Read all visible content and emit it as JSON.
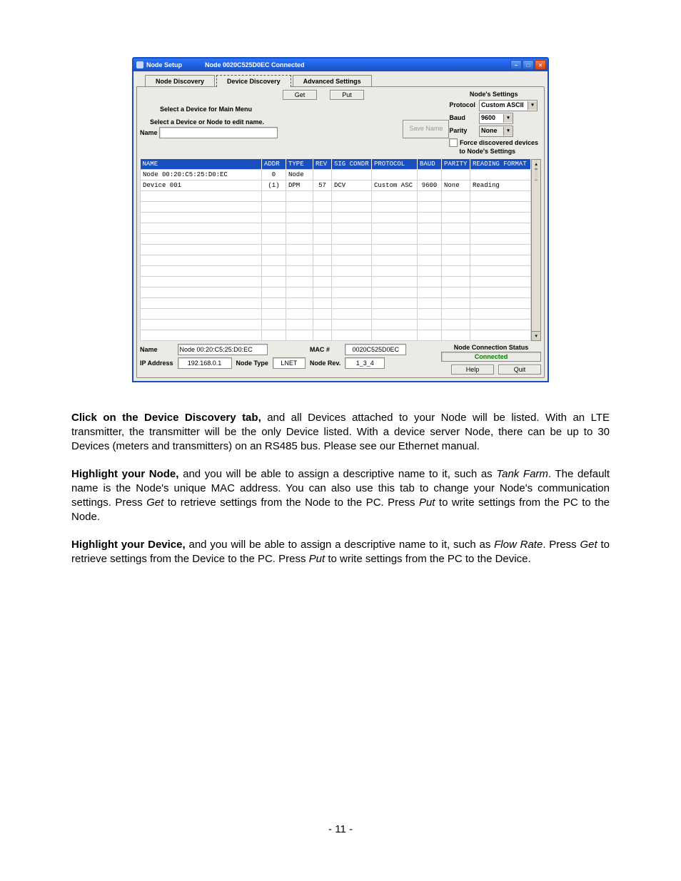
{
  "window": {
    "title_prefix": "Node Setup",
    "title_status": "Node 0020C525D0EC Connected"
  },
  "tabs": {
    "node_discovery": "Node Discovery",
    "device_discovery": "Device Discovery",
    "advanced_settings": "Advanced Settings"
  },
  "buttons": {
    "get": "Get",
    "put": "Put",
    "save_name": "Save Name",
    "help": "Help",
    "quit": "Quit"
  },
  "labels": {
    "select_device_main": "Select a Device for Main Menu",
    "select_device_edit": "Select a Device or Node to edit name.",
    "name": "Name",
    "node_settings": "Node's Settings",
    "protocol": "Protocol",
    "baud": "Baud",
    "parity": "Parity",
    "force_discovered": "Force discovered devices",
    "force_discovered2": "to Node's Settings",
    "footer_name": "Name",
    "footer_ip": "IP Address",
    "footer_mac": "MAC #",
    "footer_nodetype": "Node Type",
    "footer_noderev": "Node Rev.",
    "status_title": "Node Connection Status",
    "status_value": "Connected"
  },
  "settings": {
    "protocol": "Custom ASCII",
    "baud": "9600",
    "parity": "None",
    "parity_disabled": true
  },
  "grid": {
    "headers": {
      "name": "NAME",
      "addr": "ADDR",
      "type": "TYPE",
      "rev": "REV",
      "sig_condr": "SIG CONDR",
      "protocol": "PROTOCOL",
      "baud": "BAUD",
      "parity": "PARITY",
      "reading_format": "READING FORMAT"
    },
    "rows": [
      {
        "name": "Node 00:20:C5:25:D0:EC",
        "addr": "0",
        "type": "Node",
        "rev": "",
        "sig": "",
        "protocol": "",
        "baud": "",
        "parity": "",
        "fmt": ""
      },
      {
        "name": "Device 001",
        "addr": "(1)",
        "type": "DPM",
        "rev": "57",
        "sig": "DCV",
        "protocol": "Custom ASC",
        "baud": "9600",
        "parity": "None",
        "fmt": "Reading"
      },
      {
        "name": "",
        "addr": "",
        "type": "",
        "rev": "",
        "sig": "",
        "protocol": "",
        "baud": "",
        "parity": "",
        "fmt": ""
      },
      {
        "name": "",
        "addr": "",
        "type": "",
        "rev": "",
        "sig": "",
        "protocol": "",
        "baud": "",
        "parity": "",
        "fmt": ""
      },
      {
        "name": "",
        "addr": "",
        "type": "",
        "rev": "",
        "sig": "",
        "protocol": "",
        "baud": "",
        "parity": "",
        "fmt": ""
      },
      {
        "name": "",
        "addr": "",
        "type": "",
        "rev": "",
        "sig": "",
        "protocol": "",
        "baud": "",
        "parity": "",
        "fmt": ""
      },
      {
        "name": "",
        "addr": "",
        "type": "",
        "rev": "",
        "sig": "",
        "protocol": "",
        "baud": "",
        "parity": "",
        "fmt": ""
      },
      {
        "name": "",
        "addr": "",
        "type": "",
        "rev": "",
        "sig": "",
        "protocol": "",
        "baud": "",
        "parity": "",
        "fmt": ""
      },
      {
        "name": "",
        "addr": "",
        "type": "",
        "rev": "",
        "sig": "",
        "protocol": "",
        "baud": "",
        "parity": "",
        "fmt": ""
      },
      {
        "name": "",
        "addr": "",
        "type": "",
        "rev": "",
        "sig": "",
        "protocol": "",
        "baud": "",
        "parity": "",
        "fmt": ""
      },
      {
        "name": "",
        "addr": "",
        "type": "",
        "rev": "",
        "sig": "",
        "protocol": "",
        "baud": "",
        "parity": "",
        "fmt": ""
      },
      {
        "name": "",
        "addr": "",
        "type": "",
        "rev": "",
        "sig": "",
        "protocol": "",
        "baud": "",
        "parity": "",
        "fmt": ""
      },
      {
        "name": "",
        "addr": "",
        "type": "",
        "rev": "",
        "sig": "",
        "protocol": "",
        "baud": "",
        "parity": "",
        "fmt": ""
      },
      {
        "name": "",
        "addr": "",
        "type": "",
        "rev": "",
        "sig": "",
        "protocol": "",
        "baud": "",
        "parity": "",
        "fmt": ""
      },
      {
        "name": "",
        "addr": "",
        "type": "",
        "rev": "",
        "sig": "",
        "protocol": "",
        "baud": "",
        "parity": "",
        "fmt": ""
      },
      {
        "name": "",
        "addr": "",
        "type": "",
        "rev": "",
        "sig": "",
        "protocol": "",
        "baud": "",
        "parity": "",
        "fmt": ""
      }
    ]
  },
  "footer": {
    "name": "Node 00:20:C5:25:D0:EC",
    "ip": "192.168.0.1",
    "mac": "0020C525D0EC",
    "nodetype": "LNET",
    "noderev": "1_3_4"
  },
  "body": {
    "p1a": "Click on the Device Discovery tab,",
    "p1b": " and all Devices attached to your Node will be listed. With an LTE transmitter, the transmitter will be the only Device listed. With a device server Node, there can be up to 30 Devices (meters and transmitters) on an RS485 bus. Please see our Ethernet manual.",
    "p2a": "Highlight your Node,",
    "p2b": " and you will be able to assign a descriptive name to it, such as ",
    "p2c": "Tank Farm",
    "p2d": ". The default name is the Node's unique MAC address. You can also use this tab to change your Node's communication settings. Press ",
    "p2e": "Get",
    "p2f": " to retrieve settings from the Node to the PC. Press ",
    "p2g": "Put",
    "p2h": " to write settings from the PC to the Node.",
    "p3a": "Highlight your Device,",
    "p3b": " and you will be able to assign a descriptive name to it, such as ",
    "p3c": "Flow Rate",
    "p3d": ". Press ",
    "p3e": "Get",
    "p3f": " to retrieve settings from the Device to the PC. Press ",
    "p3g": "Put",
    "p3h": " to write settings from the PC to the Device."
  },
  "page_number": "- 11 -"
}
